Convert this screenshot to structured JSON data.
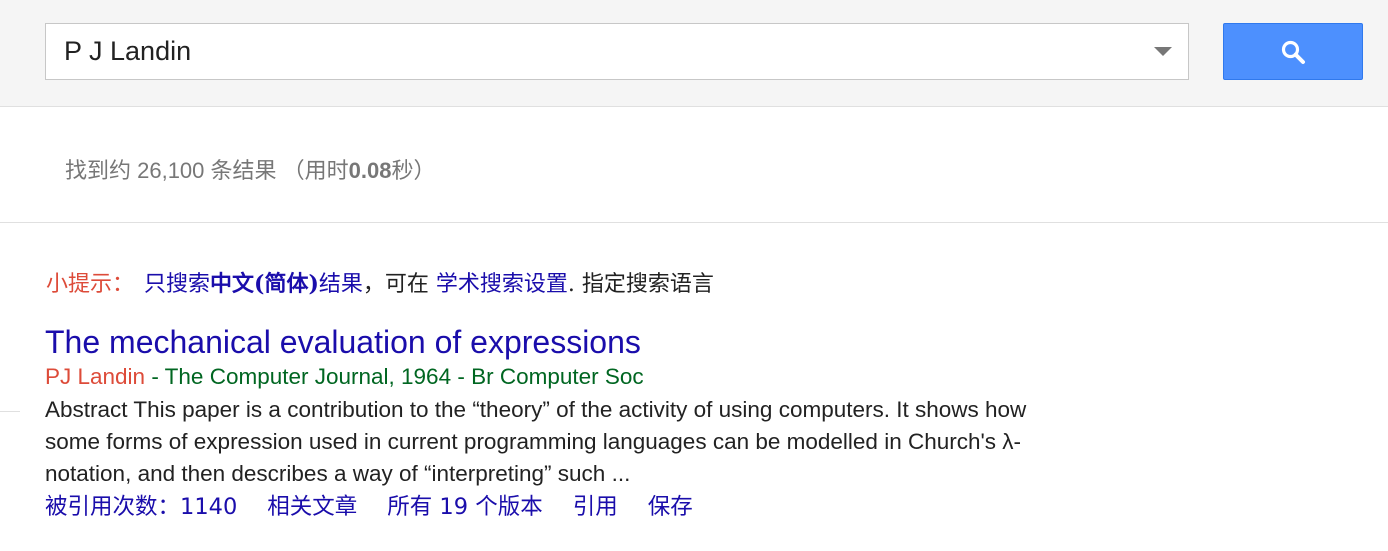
{
  "search": {
    "query": "P J Landin",
    "dropdown_icon": "chevron-down-icon",
    "button_icon": "search-icon"
  },
  "stats": {
    "prefix": "找到约 26,100 条结果 （用时",
    "time": "0.08",
    "suffix": "秒）"
  },
  "tip": {
    "label": "小提示：",
    "link1_pre": "只搜索",
    "link1_bold": "中文(简体)",
    "link1_post": "结果",
    "middle": "，可在 ",
    "link2": "学术搜索设置",
    "end": ". 指定搜索语言"
  },
  "result": {
    "title": "The mechanical evaluation of expressions",
    "author": "PJ Landin",
    "source": " - The Computer Journal, 1964 - Br Computer Soc",
    "snippet": "Abstract This paper is a contribution to the “theory” of the activity of using computers. It shows how some forms of expression used in current programming languages can be modelled in Church's λ-notation, and then describes a way of “interpreting” such ...",
    "actions": {
      "cited_by": "被引用次数：1140",
      "related": "相关文章",
      "versions": "所有 19 个版本",
      "cite": "引用",
      "save": "保存"
    }
  },
  "colors": {
    "link": "#1a0dab",
    "author": "#dd4b39",
    "source": "#006621",
    "button": "#4d90fe"
  }
}
